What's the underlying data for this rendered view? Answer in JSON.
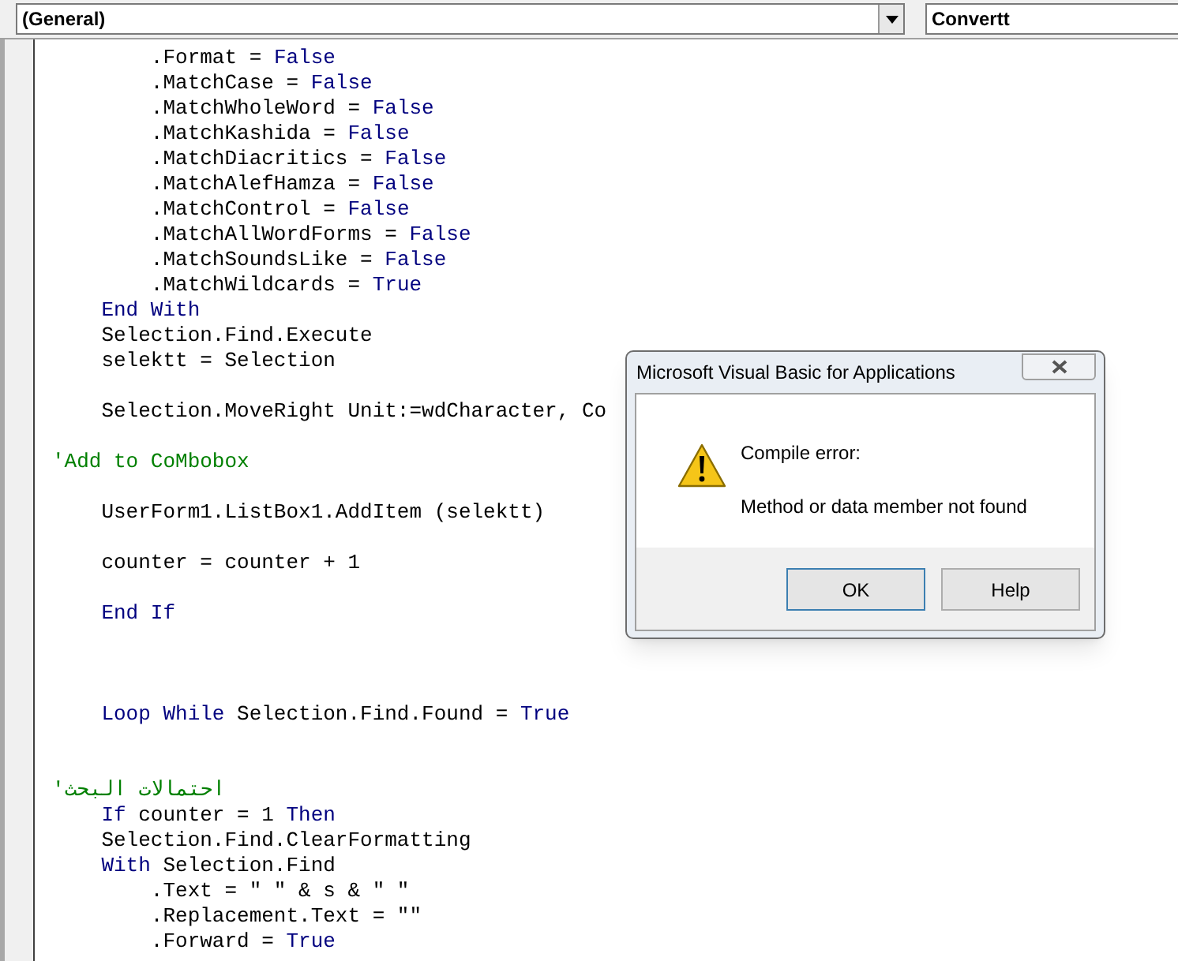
{
  "toolbar": {
    "object_dropdown": {
      "value": "(General)"
    },
    "procedure_dropdown": {
      "value": "Convertt"
    }
  },
  "code_lines": [
    {
      "kind": "code",
      "segments": [
        {
          "kind": "plain",
          "text": "        .Format = "
        },
        {
          "kind": "keyword",
          "text": "False"
        }
      ]
    },
    {
      "kind": "code",
      "segments": [
        {
          "kind": "plain",
          "text": "        .MatchCase = "
        },
        {
          "kind": "keyword",
          "text": "False"
        }
      ]
    },
    {
      "kind": "code",
      "segments": [
        {
          "kind": "plain",
          "text": "        .MatchWholeWord = "
        },
        {
          "kind": "keyword",
          "text": "False"
        }
      ]
    },
    {
      "kind": "code",
      "segments": [
        {
          "kind": "plain",
          "text": "        .MatchKashida = "
        },
        {
          "kind": "keyword",
          "text": "False"
        }
      ]
    },
    {
      "kind": "code",
      "segments": [
        {
          "kind": "plain",
          "text": "        .MatchDiacritics = "
        },
        {
          "kind": "keyword",
          "text": "False"
        }
      ]
    },
    {
      "kind": "code",
      "segments": [
        {
          "kind": "plain",
          "text": "        .MatchAlefHamza = "
        },
        {
          "kind": "keyword",
          "text": "False"
        }
      ]
    },
    {
      "kind": "code",
      "segments": [
        {
          "kind": "plain",
          "text": "        .MatchControl = "
        },
        {
          "kind": "keyword",
          "text": "False"
        }
      ]
    },
    {
      "kind": "code",
      "segments": [
        {
          "kind": "plain",
          "text": "        .MatchAllWordForms = "
        },
        {
          "kind": "keyword",
          "text": "False"
        }
      ]
    },
    {
      "kind": "code",
      "segments": [
        {
          "kind": "plain",
          "text": "        .MatchSoundsLike = "
        },
        {
          "kind": "keyword",
          "text": "False"
        }
      ]
    },
    {
      "kind": "code",
      "segments": [
        {
          "kind": "plain",
          "text": "        .MatchWildcards = "
        },
        {
          "kind": "keyword",
          "text": "True"
        }
      ]
    },
    {
      "kind": "code",
      "segments": [
        {
          "kind": "keyword",
          "text": "    End With"
        }
      ]
    },
    {
      "kind": "code",
      "segments": [
        {
          "kind": "plain",
          "text": "    Selection.Find.Execute"
        }
      ]
    },
    {
      "kind": "code",
      "segments": [
        {
          "kind": "plain",
          "text": "    selektt = Selection"
        }
      ]
    },
    {
      "kind": "blank"
    },
    {
      "kind": "code",
      "segments": [
        {
          "kind": "plain",
          "text": "    Selection.MoveRight Unit:=wdCharacter, Co"
        }
      ]
    },
    {
      "kind": "blank"
    },
    {
      "kind": "code",
      "segments": [
        {
          "kind": "comment",
          "text": "'Add to CoMbobox"
        }
      ]
    },
    {
      "kind": "blank"
    },
    {
      "kind": "code",
      "segments": [
        {
          "kind": "plain",
          "text": "    UserForm1.ListBox1.AddItem (selektt)"
        }
      ]
    },
    {
      "kind": "blank"
    },
    {
      "kind": "code",
      "segments": [
        {
          "kind": "plain",
          "text": "    counter = counter + 1"
        }
      ]
    },
    {
      "kind": "blank"
    },
    {
      "kind": "code",
      "segments": [
        {
          "kind": "keyword",
          "text": "    End If"
        }
      ]
    },
    {
      "kind": "blank"
    },
    {
      "kind": "blank"
    },
    {
      "kind": "blank"
    },
    {
      "kind": "code",
      "segments": [
        {
          "kind": "keyword",
          "text": "    Loop While"
        },
        {
          "kind": "plain",
          "text": " Selection.Find.Found = "
        },
        {
          "kind": "keyword",
          "text": "True"
        }
      ]
    },
    {
      "kind": "blank"
    },
    {
      "kind": "blank"
    },
    {
      "kind": "code",
      "segments": [
        {
          "kind": "comment",
          "text": "'احتمالات البحث"
        }
      ]
    },
    {
      "kind": "code",
      "segments": [
        {
          "kind": "keyword",
          "text": "    If"
        },
        {
          "kind": "plain",
          "text": " counter = 1 "
        },
        {
          "kind": "keyword",
          "text": "Then"
        }
      ]
    },
    {
      "kind": "code",
      "segments": [
        {
          "kind": "plain",
          "text": "    Selection.Find.ClearFormatting"
        }
      ]
    },
    {
      "kind": "code",
      "segments": [
        {
          "kind": "keyword",
          "text": "    With"
        },
        {
          "kind": "plain",
          "text": " Selection.Find"
        }
      ]
    },
    {
      "kind": "code",
      "segments": [
        {
          "kind": "plain",
          "text": "        .Text = \" \" & s & \" \""
        }
      ]
    },
    {
      "kind": "code",
      "segments": [
        {
          "kind": "plain",
          "text": "        .Replacement.Text = \"\""
        }
      ]
    },
    {
      "kind": "code",
      "segments": [
        {
          "kind": "plain",
          "text": "        .Forward = "
        },
        {
          "kind": "keyword",
          "text": "True"
        }
      ]
    }
  ],
  "dialog": {
    "title": "Microsoft Visual Basic for Applications",
    "heading": "Compile error:",
    "message": "Method or data member not found",
    "buttons": [
      "OK",
      "Help"
    ]
  }
}
